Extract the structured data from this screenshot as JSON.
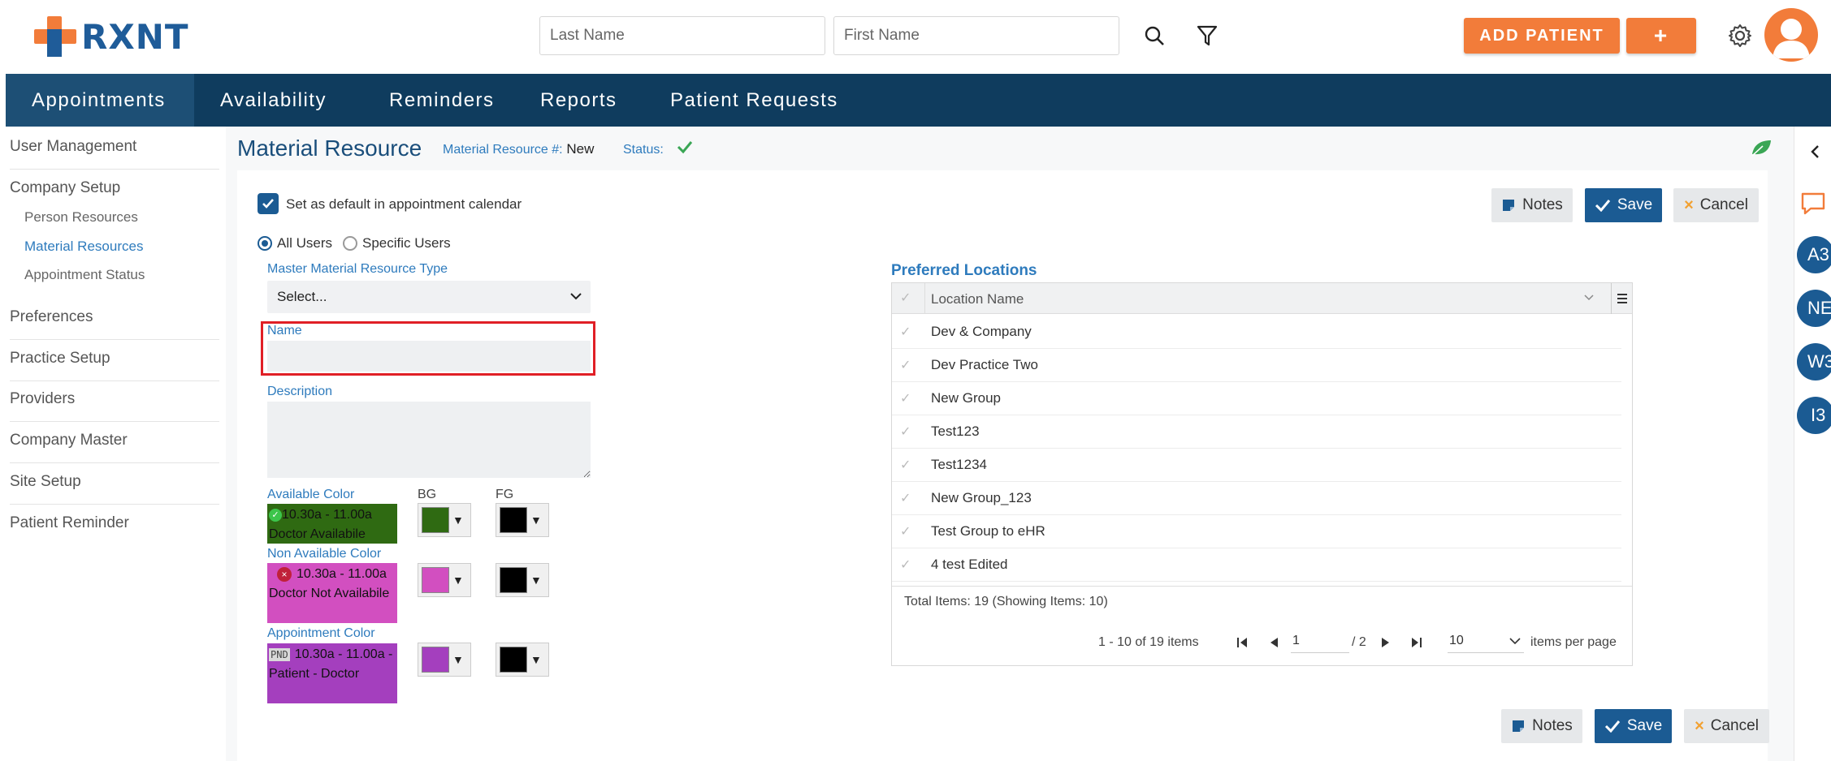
{
  "brand": {
    "name": "RXNT",
    "accent": "#f27c3a",
    "primary": "#1b5b93"
  },
  "header": {
    "last_name_placeholder": "Last Name",
    "first_name_placeholder": "First Name",
    "search_icon": "search-icon",
    "filter_icon": "filter-icon",
    "add_patient_label": "ADD PATIENT",
    "plus_label": "+",
    "settings_icon": "gear-icon"
  },
  "nav": {
    "items": [
      "Appointments",
      "Availability",
      "Reminders",
      "Reports",
      "Patient Requests"
    ],
    "active": "Appointments"
  },
  "sidebar": {
    "user_management": "User Management",
    "company_setup": "Company Setup",
    "sub_items": [
      "Person Resources",
      "Material Resources",
      "Appointment Status"
    ],
    "active_sub": "Material Resources",
    "preferences": "Preferences",
    "practice_setup": "Practice Setup",
    "providers": "Providers",
    "company_master": "Company Master",
    "site_setup": "Site Setup",
    "patient_reminder": "Patient Reminder"
  },
  "page": {
    "title": "Material Resource",
    "resource_no_label": "Material Resource #:",
    "resource_no_value": "New",
    "status_label": "Status:"
  },
  "toolbar": {
    "notes_label": "Notes",
    "save_label": "Save",
    "cancel_label": "Cancel"
  },
  "form": {
    "default_label": "Set as default in appointment calendar",
    "all_users_label": "All Users",
    "specific_users_label": "Specific Users",
    "master_type_label": "Master Material Resource Type",
    "master_type_value": "Select...",
    "name_label": "Name",
    "name_value": "",
    "description_label": "Description",
    "description_value": "",
    "bg_label": "BG",
    "fg_label": "FG",
    "available_color_label": "Available Color",
    "available_preview": "10.30a - 11.00a Doctor Availabile",
    "available_bg": "#2f6a12",
    "available_fg": "#000000",
    "non_available_color_label": "Non Available Color",
    "non_available_preview": "10.30a - 11.00a Doctor Not Availabile",
    "non_available_bg": "#d24fc0",
    "non_available_fg": "#000000",
    "appointment_color_label": "Appointment Color",
    "appointment_badge": "PND",
    "appointment_preview": "10.30a - 11.00a - Patient - Doctor",
    "appointment_bg": "#a43fbe",
    "appointment_fg": "#000000"
  },
  "locations": {
    "title": "Preferred Locations",
    "column": "Location Name",
    "rows": [
      "Dev & Company",
      "Dev Practice Two",
      "New Group",
      "Test123",
      "Test1234",
      "New Group_123",
      "Test Group to eHR",
      "4 test Edited"
    ],
    "total_text": "Total Items: 19 (Showing Items: 10)",
    "range_text": "1 - 10 of 19 items",
    "page_value": "1",
    "page_total": "/ 2",
    "page_size": "10",
    "per_page_label": "items per page"
  },
  "right_rail": {
    "badges": [
      "A3",
      "NE",
      "W3",
      "I3"
    ]
  }
}
